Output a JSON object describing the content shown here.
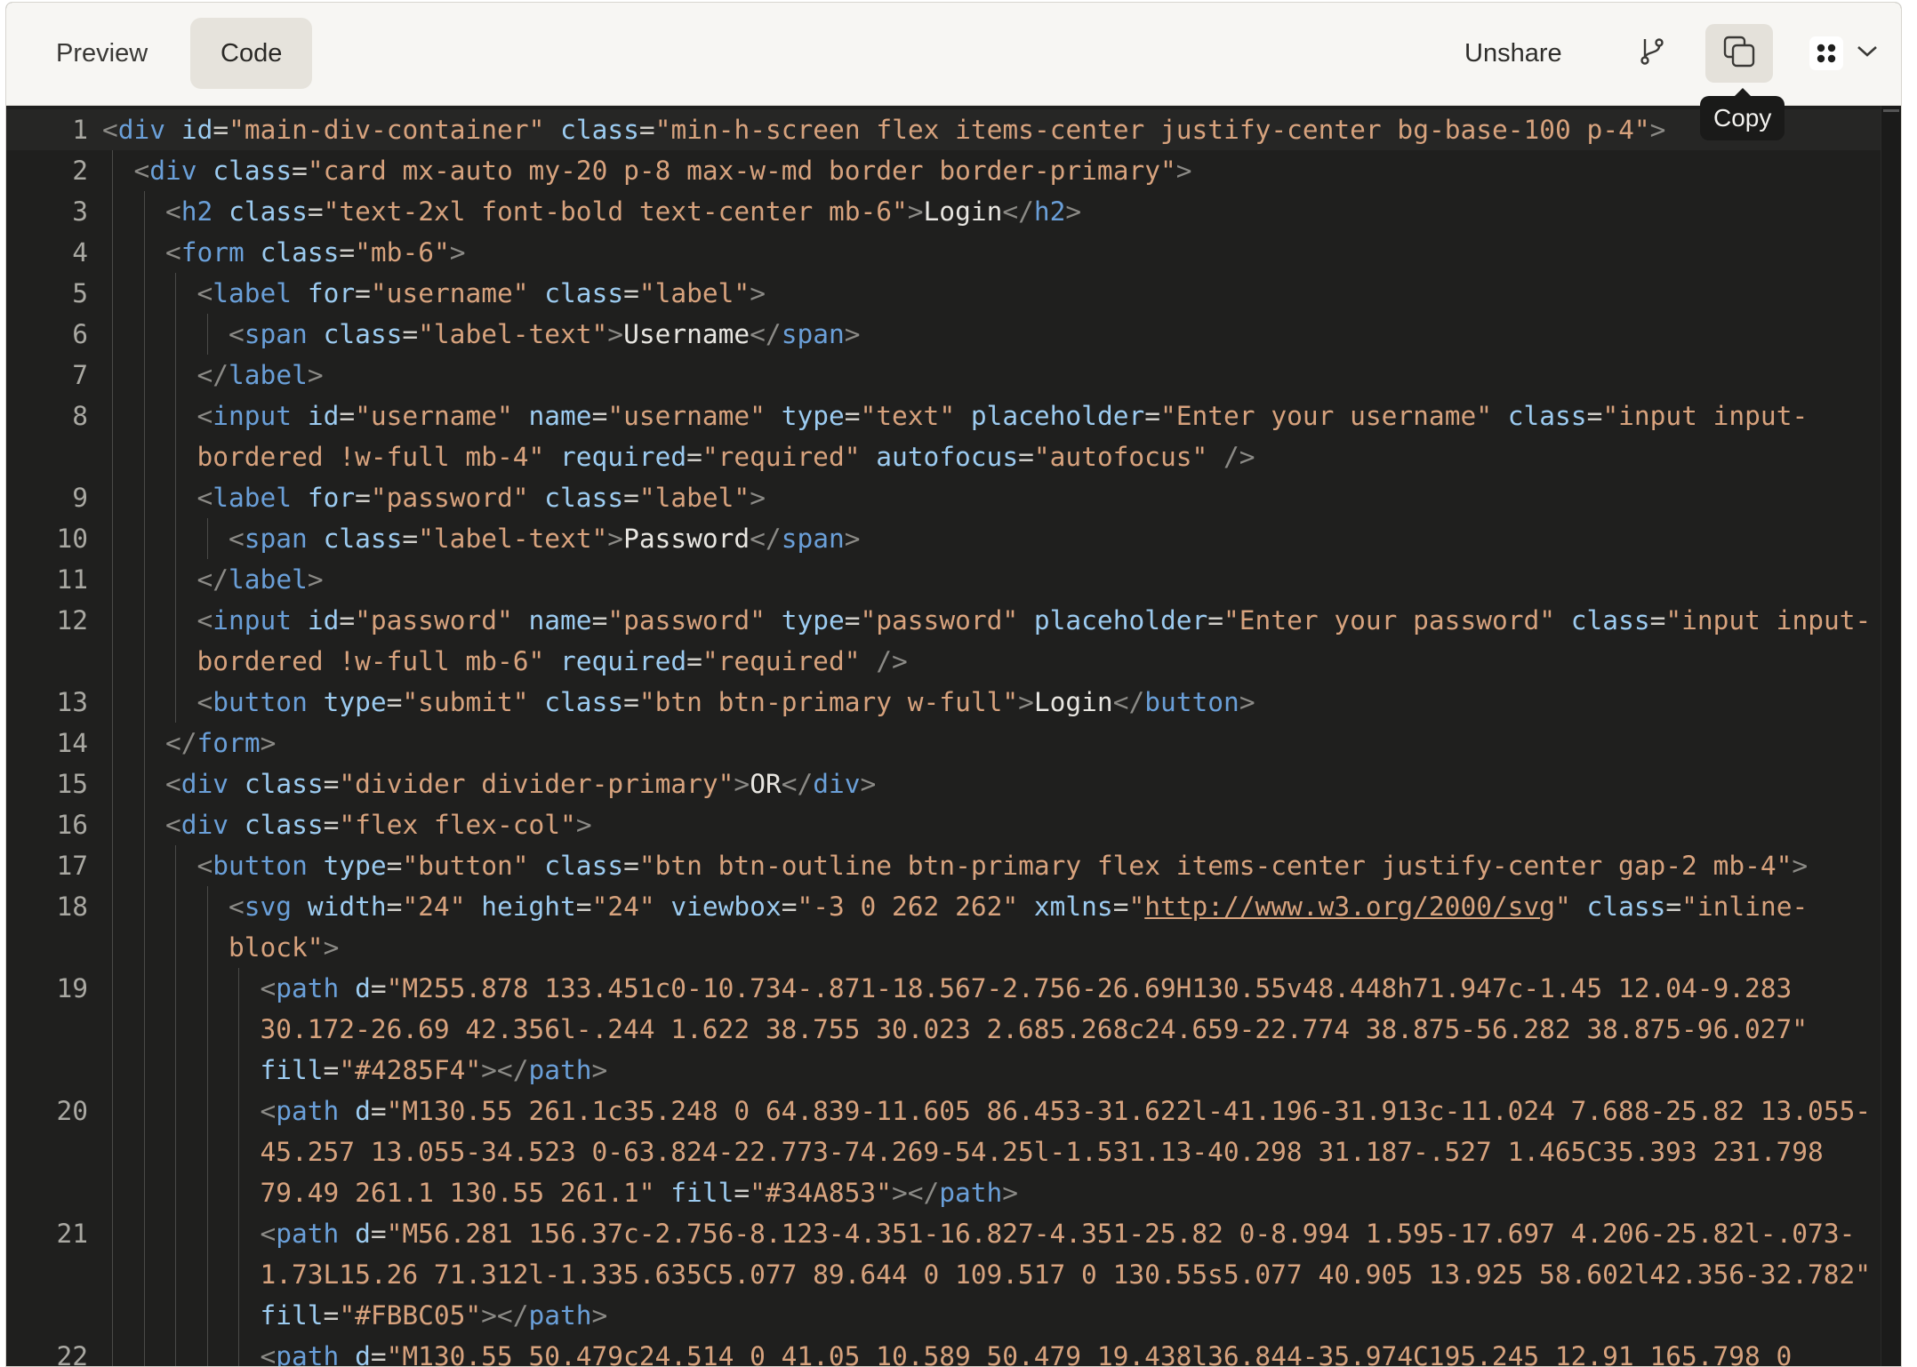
{
  "toolbar": {
    "preview_label": "Preview",
    "code_label": "Code",
    "unshare_label": "Unshare",
    "copy_tooltip": "Copy",
    "branch_icon": "git-branch-icon",
    "copy_icon": "copy-icon",
    "apps_icon": "apps-grid-icon",
    "chevron_icon": "chevron-down-icon"
  },
  "colors": {
    "tag": "#6a9fd8",
    "attr": "#9ccbf0",
    "value": "#d7a27d",
    "text": "#e8e6e1",
    "editor_bg": "#1f1f1e"
  },
  "code": {
    "lines": [
      {
        "n": "1",
        "indent": 0,
        "tokens": [
          [
            "br",
            "<"
          ],
          [
            "tag",
            "div"
          ],
          [
            "sp",
            " "
          ],
          [
            "attr",
            "id"
          ],
          [
            "eq",
            "="
          ],
          [
            "val",
            "\"main-div-container\""
          ],
          [
            "sp",
            " "
          ],
          [
            "attr",
            "class"
          ],
          [
            "eq",
            "="
          ],
          [
            "val",
            "\"min-h-screen flex items-center justify-center bg-base-100 p-4\""
          ],
          [
            "br",
            ">"
          ]
        ]
      },
      {
        "n": "2",
        "indent": 1,
        "tokens": [
          [
            "br",
            "<"
          ],
          [
            "tag",
            "div"
          ],
          [
            "sp",
            " "
          ],
          [
            "attr",
            "class"
          ],
          [
            "eq",
            "="
          ],
          [
            "val",
            "\"card mx-auto my-20 p-8 max-w-md border border-primary\""
          ],
          [
            "br",
            ">"
          ]
        ]
      },
      {
        "n": "3",
        "indent": 2,
        "tokens": [
          [
            "br",
            "<"
          ],
          [
            "tag",
            "h2"
          ],
          [
            "sp",
            " "
          ],
          [
            "attr",
            "class"
          ],
          [
            "eq",
            "="
          ],
          [
            "val",
            "\"text-2xl font-bold text-center mb-6\""
          ],
          [
            "br",
            ">"
          ],
          [
            "tx",
            "Login"
          ],
          [
            "br",
            "</"
          ],
          [
            "tag",
            "h2"
          ],
          [
            "br",
            ">"
          ]
        ]
      },
      {
        "n": "4",
        "indent": 2,
        "tokens": [
          [
            "br",
            "<"
          ],
          [
            "tag",
            "form"
          ],
          [
            "sp",
            " "
          ],
          [
            "attr",
            "class"
          ],
          [
            "eq",
            "="
          ],
          [
            "val",
            "\"mb-6\""
          ],
          [
            "br",
            ">"
          ]
        ]
      },
      {
        "n": "5",
        "indent": 3,
        "tokens": [
          [
            "br",
            "<"
          ],
          [
            "tag",
            "label"
          ],
          [
            "sp",
            " "
          ],
          [
            "attr",
            "for"
          ],
          [
            "eq",
            "="
          ],
          [
            "val",
            "\"username\""
          ],
          [
            "sp",
            " "
          ],
          [
            "attr",
            "class"
          ],
          [
            "eq",
            "="
          ],
          [
            "val",
            "\"label\""
          ],
          [
            "br",
            ">"
          ]
        ]
      },
      {
        "n": "6",
        "indent": 4,
        "tokens": [
          [
            "br",
            "<"
          ],
          [
            "tag",
            "span"
          ],
          [
            "sp",
            " "
          ],
          [
            "attr",
            "class"
          ],
          [
            "eq",
            "="
          ],
          [
            "val",
            "\"label-text\""
          ],
          [
            "br",
            ">"
          ],
          [
            "tx",
            "Username"
          ],
          [
            "br",
            "</"
          ],
          [
            "tag",
            "span"
          ],
          [
            "br",
            ">"
          ]
        ]
      },
      {
        "n": "7",
        "indent": 3,
        "tokens": [
          [
            "br",
            "</"
          ],
          [
            "tag",
            "label"
          ],
          [
            "br",
            ">"
          ]
        ]
      },
      {
        "n": "8",
        "indent": 3,
        "tokens": [
          [
            "br",
            "<"
          ],
          [
            "tag",
            "input"
          ],
          [
            "sp",
            " "
          ],
          [
            "attr",
            "id"
          ],
          [
            "eq",
            "="
          ],
          [
            "val",
            "\"username\""
          ],
          [
            "sp",
            " "
          ],
          [
            "attr",
            "name"
          ],
          [
            "eq",
            "="
          ],
          [
            "val",
            "\"username\""
          ],
          [
            "sp",
            " "
          ],
          [
            "attr",
            "type"
          ],
          [
            "eq",
            "="
          ],
          [
            "val",
            "\"text\""
          ],
          [
            "sp",
            " "
          ],
          [
            "attr",
            "placeholder"
          ],
          [
            "eq",
            "="
          ],
          [
            "val",
            "\"Enter your username\""
          ],
          [
            "sp",
            " "
          ],
          [
            "attr",
            "class"
          ],
          [
            "eq",
            "="
          ],
          [
            "val",
            "\"input input-bordered !w-full mb-4\""
          ],
          [
            "sp",
            " "
          ],
          [
            "attr",
            "required"
          ],
          [
            "eq",
            "="
          ],
          [
            "val",
            "\"required\""
          ],
          [
            "sp",
            " "
          ],
          [
            "attr",
            "autofocus"
          ],
          [
            "eq",
            "="
          ],
          [
            "val",
            "\"autofocus\""
          ],
          [
            "sp",
            " "
          ],
          [
            "br",
            "/>"
          ]
        ]
      },
      {
        "n": "9",
        "indent": 3,
        "tokens": [
          [
            "br",
            "<"
          ],
          [
            "tag",
            "label"
          ],
          [
            "sp",
            " "
          ],
          [
            "attr",
            "for"
          ],
          [
            "eq",
            "="
          ],
          [
            "val",
            "\"password\""
          ],
          [
            "sp",
            " "
          ],
          [
            "attr",
            "class"
          ],
          [
            "eq",
            "="
          ],
          [
            "val",
            "\"label\""
          ],
          [
            "br",
            ">"
          ]
        ]
      },
      {
        "n": "10",
        "indent": 4,
        "tokens": [
          [
            "br",
            "<"
          ],
          [
            "tag",
            "span"
          ],
          [
            "sp",
            " "
          ],
          [
            "attr",
            "class"
          ],
          [
            "eq",
            "="
          ],
          [
            "val",
            "\"label-text\""
          ],
          [
            "br",
            ">"
          ],
          [
            "tx",
            "Password"
          ],
          [
            "br",
            "</"
          ],
          [
            "tag",
            "span"
          ],
          [
            "br",
            ">"
          ]
        ]
      },
      {
        "n": "11",
        "indent": 3,
        "tokens": [
          [
            "br",
            "</"
          ],
          [
            "tag",
            "label"
          ],
          [
            "br",
            ">"
          ]
        ]
      },
      {
        "n": "12",
        "indent": 3,
        "tokens": [
          [
            "br",
            "<"
          ],
          [
            "tag",
            "input"
          ],
          [
            "sp",
            " "
          ],
          [
            "attr",
            "id"
          ],
          [
            "eq",
            "="
          ],
          [
            "val",
            "\"password\""
          ],
          [
            "sp",
            " "
          ],
          [
            "attr",
            "name"
          ],
          [
            "eq",
            "="
          ],
          [
            "val",
            "\"password\""
          ],
          [
            "sp",
            " "
          ],
          [
            "attr",
            "type"
          ],
          [
            "eq",
            "="
          ],
          [
            "val",
            "\"password\""
          ],
          [
            "sp",
            " "
          ],
          [
            "attr",
            "placeholder"
          ],
          [
            "eq",
            "="
          ],
          [
            "val",
            "\"Enter your password\""
          ],
          [
            "sp",
            " "
          ],
          [
            "attr",
            "class"
          ],
          [
            "eq",
            "="
          ],
          [
            "val",
            "\"input input-bordered !w-full mb-6\""
          ],
          [
            "sp",
            " "
          ],
          [
            "attr",
            "required"
          ],
          [
            "eq",
            "="
          ],
          [
            "val",
            "\"required\""
          ],
          [
            "sp",
            " "
          ],
          [
            "br",
            "/>"
          ]
        ]
      },
      {
        "n": "13",
        "indent": 3,
        "tokens": [
          [
            "br",
            "<"
          ],
          [
            "tag",
            "button"
          ],
          [
            "sp",
            " "
          ],
          [
            "attr",
            "type"
          ],
          [
            "eq",
            "="
          ],
          [
            "val",
            "\"submit\""
          ],
          [
            "sp",
            " "
          ],
          [
            "attr",
            "class"
          ],
          [
            "eq",
            "="
          ],
          [
            "val",
            "\"btn btn-primary w-full\""
          ],
          [
            "br",
            ">"
          ],
          [
            "tx",
            "Login"
          ],
          [
            "br",
            "</"
          ],
          [
            "tag",
            "button"
          ],
          [
            "br",
            ">"
          ]
        ]
      },
      {
        "n": "14",
        "indent": 2,
        "tokens": [
          [
            "br",
            "</"
          ],
          [
            "tag",
            "form"
          ],
          [
            "br",
            ">"
          ]
        ]
      },
      {
        "n": "15",
        "indent": 2,
        "tokens": [
          [
            "br",
            "<"
          ],
          [
            "tag",
            "div"
          ],
          [
            "sp",
            " "
          ],
          [
            "attr",
            "class"
          ],
          [
            "eq",
            "="
          ],
          [
            "val",
            "\"divider divider-primary\""
          ],
          [
            "br",
            ">"
          ],
          [
            "tx",
            "OR"
          ],
          [
            "br",
            "</"
          ],
          [
            "tag",
            "div"
          ],
          [
            "br",
            ">"
          ]
        ]
      },
      {
        "n": "16",
        "indent": 2,
        "tokens": [
          [
            "br",
            "<"
          ],
          [
            "tag",
            "div"
          ],
          [
            "sp",
            " "
          ],
          [
            "attr",
            "class"
          ],
          [
            "eq",
            "="
          ],
          [
            "val",
            "\"flex flex-col\""
          ],
          [
            "br",
            ">"
          ]
        ]
      },
      {
        "n": "17",
        "indent": 3,
        "tokens": [
          [
            "br",
            "<"
          ],
          [
            "tag",
            "button"
          ],
          [
            "sp",
            " "
          ],
          [
            "attr",
            "type"
          ],
          [
            "eq",
            "="
          ],
          [
            "val",
            "\"button\""
          ],
          [
            "sp",
            " "
          ],
          [
            "attr",
            "class"
          ],
          [
            "eq",
            "="
          ],
          [
            "val",
            "\"btn btn-outline btn-primary flex items-center justify-center gap-2 mb-4\""
          ],
          [
            "br",
            ">"
          ]
        ]
      },
      {
        "n": "18",
        "indent": 4,
        "tokens": [
          [
            "br",
            "<"
          ],
          [
            "tag",
            "svg"
          ],
          [
            "sp",
            " "
          ],
          [
            "attr",
            "width"
          ],
          [
            "eq",
            "="
          ],
          [
            "val",
            "\"24\""
          ],
          [
            "sp",
            " "
          ],
          [
            "attr",
            "height"
          ],
          [
            "eq",
            "="
          ],
          [
            "val",
            "\"24\""
          ],
          [
            "sp",
            " "
          ],
          [
            "attr",
            "viewbox"
          ],
          [
            "eq",
            "="
          ],
          [
            "val",
            "\"-3 0 262 262\""
          ],
          [
            "sp",
            " "
          ],
          [
            "attr",
            "xmlns"
          ],
          [
            "eq",
            "="
          ],
          [
            "val",
            "\""
          ],
          [
            "link",
            "http://www.w3.org/2000/svg"
          ],
          [
            "val",
            "\""
          ],
          [
            "sp",
            " "
          ],
          [
            "attr",
            "class"
          ],
          [
            "eq",
            "="
          ],
          [
            "val",
            "\"inline-block\""
          ],
          [
            "br",
            ">"
          ]
        ]
      },
      {
        "n": "19",
        "indent": 5,
        "tokens": [
          [
            "br",
            "<"
          ],
          [
            "tag",
            "path"
          ],
          [
            "sp",
            " "
          ],
          [
            "attr",
            "d"
          ],
          [
            "eq",
            "="
          ],
          [
            "val",
            "\"M255.878 133.451c0-10.734-.871-18.567-2.756-26.69H130.55v48.448h71.947c-1.45 12.04-9.283 30.172-26.69 42.356l-.244 1.622 38.755 30.023 2.685.268c24.659-22.774 38.875-56.282 38.875-96.027\""
          ],
          [
            "sp",
            " "
          ],
          [
            "attr",
            "fill"
          ],
          [
            "eq",
            "="
          ],
          [
            "val",
            "\"#4285F4\""
          ],
          [
            "br",
            "></"
          ],
          [
            "tag",
            "path"
          ],
          [
            "br",
            ">"
          ]
        ]
      },
      {
        "n": "20",
        "indent": 5,
        "tokens": [
          [
            "br",
            "<"
          ],
          [
            "tag",
            "path"
          ],
          [
            "sp",
            " "
          ],
          [
            "attr",
            "d"
          ],
          [
            "eq",
            "="
          ],
          [
            "val",
            "\"M130.55 261.1c35.248 0 64.839-11.605 86.453-31.622l-41.196-31.913c-11.024 7.688-25.82 13.055-45.257 13.055-34.523 0-63.824-22.773-74.269-54.25l-1.531.13-40.298 31.187-.527 1.465C35.393 231.798 79.49 261.1 130.55 261.1\""
          ],
          [
            "sp",
            " "
          ],
          [
            "attr",
            "fill"
          ],
          [
            "eq",
            "="
          ],
          [
            "val",
            "\"#34A853\""
          ],
          [
            "br",
            "></"
          ],
          [
            "tag",
            "path"
          ],
          [
            "br",
            ">"
          ]
        ]
      },
      {
        "n": "21",
        "indent": 5,
        "tokens": [
          [
            "br",
            "<"
          ],
          [
            "tag",
            "path"
          ],
          [
            "sp",
            " "
          ],
          [
            "attr",
            "d"
          ],
          [
            "eq",
            "="
          ],
          [
            "val",
            "\"M56.281 156.37c-2.756-8.123-4.351-16.827-4.351-25.82 0-8.994 1.595-17.697 4.206-25.82l-.073-1.73L15.26 71.312l-1.335.635C5.077 89.644 0 109.517 0 130.55s5.077 40.905 13.925 58.602l42.356-32.782\""
          ],
          [
            "sp",
            " "
          ],
          [
            "attr",
            "fill"
          ],
          [
            "eq",
            "="
          ],
          [
            "val",
            "\"#FBBC05\""
          ],
          [
            "br",
            "></"
          ],
          [
            "tag",
            "path"
          ],
          [
            "br",
            ">"
          ]
        ]
      },
      {
        "n": "22",
        "indent": 5,
        "tokens": [
          [
            "br",
            "<"
          ],
          [
            "tag",
            "path"
          ],
          [
            "sp",
            " "
          ],
          [
            "attr",
            "d"
          ],
          [
            "eq",
            "="
          ],
          [
            "val",
            "\"M130.55 50.479c24.514 0 41.05 10.589 50.479 19.438l36.844-35.974C195.245 12.91 165.798 0"
          ]
        ]
      }
    ]
  }
}
